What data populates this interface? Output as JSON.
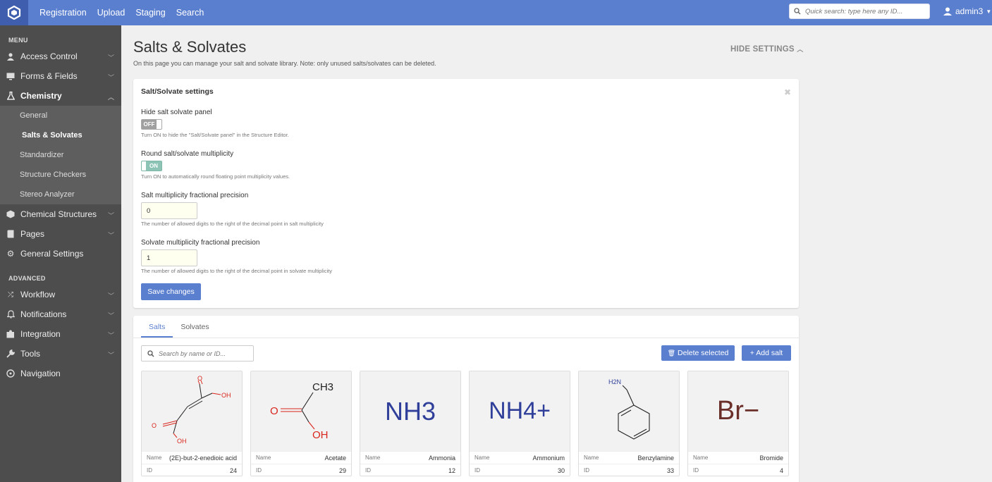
{
  "topbar": {
    "nav": [
      "Registration",
      "Upload",
      "Staging",
      "Search"
    ],
    "quick_search_placeholder": "Quick search: type here any ID...",
    "user": "admin3"
  },
  "sidebar": {
    "menu_heading": "MENU",
    "items": [
      {
        "label": "Access Control",
        "icon": "users-icon"
      },
      {
        "label": "Forms & Fields",
        "icon": "monitor-icon"
      },
      {
        "label": "Chemistry",
        "icon": "flask-icon"
      }
    ],
    "chemistry_sub": [
      "General",
      "Salts & Solvates",
      "Standardizer",
      "Structure Checkers",
      "Stereo Analyzer"
    ],
    "items2": [
      {
        "label": "Chemical Structures",
        "icon": "cube-icon"
      },
      {
        "label": "Pages",
        "icon": "pages-icon"
      },
      {
        "label": "General Settings",
        "icon": "gear-icon"
      }
    ],
    "advanced_heading": "ADVANCED",
    "advanced": [
      {
        "label": "Workflow",
        "icon": "shuffle-icon"
      },
      {
        "label": "Notifications",
        "icon": "bell-icon"
      },
      {
        "label": "Integration",
        "icon": "puzzle-icon"
      },
      {
        "label": "Tools",
        "icon": "wrench-icon"
      },
      {
        "label": "Navigation",
        "icon": "compass-icon"
      }
    ]
  },
  "page": {
    "title": "Salts & Solvates",
    "subtitle": "On this page you can manage your salt and solvate library. Note: only unused salts/solvates can be deleted.",
    "hide_settings": "HIDE SETTINGS"
  },
  "settings": {
    "title": "Salt/Solvate settings",
    "hide_panel_label": "Hide salt solvate panel",
    "hide_panel_state": "OFF",
    "hide_panel_help": "Turn ON to hide the \"Salt/Solvate panel\" in the Structure Editor.",
    "round_label": "Round salt/solvate multiplicity",
    "round_state": "ON",
    "round_help": "Turn ON to automatically round floating point multiplicity values.",
    "salt_precision_label": "Salt multiplicity fractional precision",
    "salt_precision_value": "0",
    "salt_precision_help": "The number of allowed digits to the right of the decimal point in salt multiplicity",
    "solvate_precision_label": "Solvate multiplicity fractional precision",
    "solvate_precision_value": "1",
    "solvate_precision_help": "The number of allowed digits to the right of the decimal point in solvate multiplicity",
    "save_label": "Save changes"
  },
  "library": {
    "tabs": [
      "Salts",
      "Solvates"
    ],
    "search_placeholder": "Search by name or ID...",
    "delete_label": "Delete selected",
    "add_label": "+ Add salt",
    "name_label": "Name",
    "id_label": "ID",
    "salts": [
      {
        "name": "(2E)-but-2-enedioic acid",
        "id": "24"
      },
      {
        "name": "Acetate",
        "id": "29"
      },
      {
        "name": "Ammonia",
        "id": "12"
      },
      {
        "name": "Ammonium",
        "id": "30"
      },
      {
        "name": "Benzylamine",
        "id": "33"
      },
      {
        "name": "Bromide",
        "id": "4"
      }
    ],
    "structures": {
      "fumaric_oh_top": "OH",
      "fumaric_oh_bottom": "OH",
      "fumaric_o_top": "O",
      "fumaric_o_bottom": "O",
      "acetate_ch3": "CH3",
      "acetate_o": "O",
      "acetate_oh": "OH",
      "ammonia": "NH3",
      "ammonium": "NH4+",
      "benzylamine_nh2": "H2N",
      "bromide": "Br−"
    }
  },
  "colors": {
    "accent": "#5b7fcf",
    "sidebar": "#4d4d4d",
    "molecule_blue": "#2f3f9a",
    "oxygen_red": "#d9261c",
    "bromine": "#6b2f2a"
  }
}
